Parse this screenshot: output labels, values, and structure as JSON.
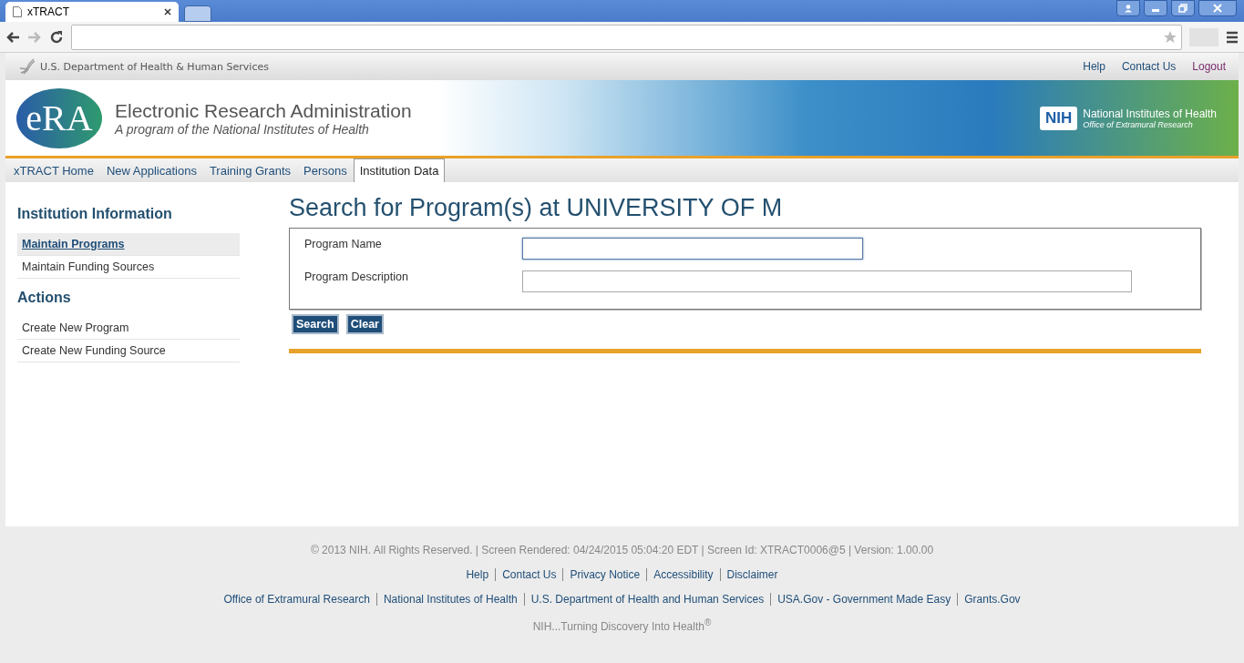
{
  "browser": {
    "tab_title": "xTRACT"
  },
  "top_bar": {
    "agency": "U.S. Department of Health & Human Services",
    "links": [
      {
        "label": "Help",
        "kind": "link"
      },
      {
        "label": "Contact Us",
        "kind": "link"
      },
      {
        "label": "Logout",
        "kind": "logout"
      }
    ]
  },
  "banner": {
    "logo_text": "eRA",
    "title": "Electronic Research Administration",
    "subtitle": "A program of the National Institutes of Health",
    "nih_mark": "NIH",
    "nih_name": "National Institutes of Health",
    "nih_office": "Office of  Extramural Research"
  },
  "tabs": [
    {
      "label": "xTRACT Home",
      "selected": false
    },
    {
      "label": "New Applications",
      "selected": false
    },
    {
      "label": "Training Grants",
      "selected": false
    },
    {
      "label": "Persons",
      "selected": false
    },
    {
      "label": "Institution Data",
      "selected": true
    }
  ],
  "sidebar": {
    "sections": [
      {
        "heading": "Institution Information",
        "items": [
          {
            "label": "Maintain Programs",
            "selected": true
          },
          {
            "label": "Maintain Funding Sources",
            "selected": false
          }
        ]
      },
      {
        "heading": "Actions",
        "items": [
          {
            "label": "Create New Program",
            "selected": false
          },
          {
            "label": "Create New Funding Source",
            "selected": false
          }
        ]
      }
    ]
  },
  "page_title": "Search for Program(s) at UNIVERSITY OF M",
  "form": {
    "fields": [
      {
        "label": "Program Name",
        "focused": true,
        "kind": "short"
      },
      {
        "label": "Program Description",
        "focused": false,
        "kind": "long"
      }
    ],
    "buttons": [
      "Search",
      "Clear"
    ]
  },
  "footer": {
    "copyright": "© 2013 NIH. All Rights Reserved. | Screen Rendered: 04/24/2015 05:04:20 EDT | Screen Id: XTRACT0006@5 | Version: 1.00.00",
    "links": [
      "Help",
      "Contact Us",
      "Privacy Notice",
      "Accessibility",
      "Disclaimer"
    ],
    "external_links": [
      "Office of Extramural Research",
      "National Institutes of Health",
      "U.S. Department of Health and Human Services",
      "USA.Gov - Government Made Easy",
      "Grants.Gov"
    ],
    "tagline": "NIH...Turning Discovery Into Health$^{®}$"
  }
}
